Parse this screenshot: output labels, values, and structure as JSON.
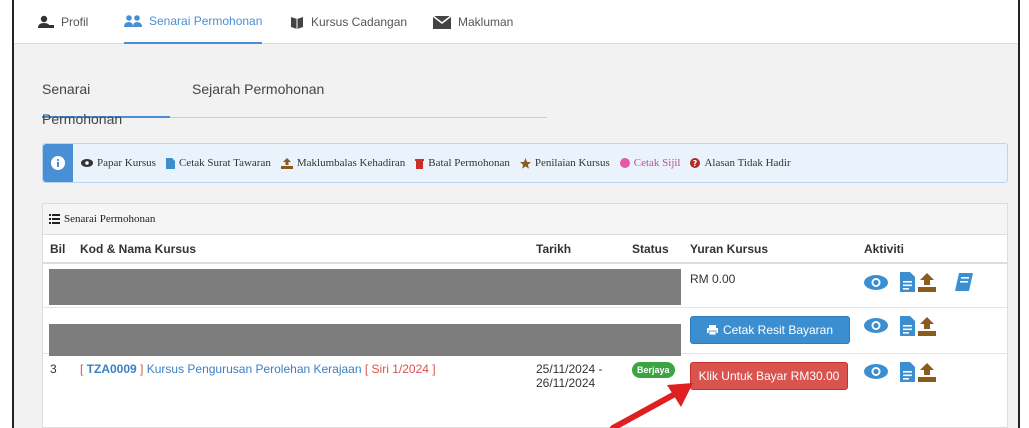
{
  "topnav": {
    "tabs": [
      {
        "label": "Profil",
        "icon": "user-icon"
      },
      {
        "label": "Senarai Permohonan",
        "icon": "users-icon",
        "active": true
      },
      {
        "label": "Kursus Cadangan",
        "icon": "book-icon"
      },
      {
        "label": "Makluman",
        "icon": "envelope-icon"
      }
    ]
  },
  "subtabs": [
    "Senarai Permohonan",
    "Sejarah Permohonan"
  ],
  "infobar": {
    "items": [
      {
        "label": "Papar Kursus",
        "icon": "eye-icon"
      },
      {
        "label": "Cetak Surat Tawaran",
        "icon": "file-icon"
      },
      {
        "label": "Maklumbalas Kehadiran",
        "icon": "upload-icon"
      },
      {
        "label": "Batal Permohonan",
        "icon": "trash-icon"
      },
      {
        "label": "Penilaian Kursus",
        "icon": "star-icon"
      },
      {
        "label": "Cetak Sijil",
        "icon": "circle-icon"
      },
      {
        "label": "Alasan Tidak Hadir",
        "icon": "question-icon"
      }
    ]
  },
  "panel": {
    "title": "Senarai Permohonan",
    "columns": [
      "Bil",
      "Kod & Nama Kursus",
      "Tarikh",
      "Status",
      "Yuran Kursus",
      "Aktiviti"
    ],
    "rows": [
      {
        "fee": "RM 0.00"
      },
      {
        "button": "Cetak Resit Bayaran"
      },
      {
        "bil": "3",
        "code": "TZA0009",
        "name": "Kursus Pengurusan Perolehan Kerajaan",
        "series": "Siri 1/2024",
        "date_start": "25/11/2024 -",
        "date_end": "26/11/2024",
        "status": "Berjaya",
        "button": "Klik Untuk Bayar RM30.00"
      }
    ]
  },
  "colors": {
    "accent": "#4a8fd6",
    "danger": "#d9534f",
    "success": "#3aa541",
    "annotation_arrow": "#e02020"
  }
}
